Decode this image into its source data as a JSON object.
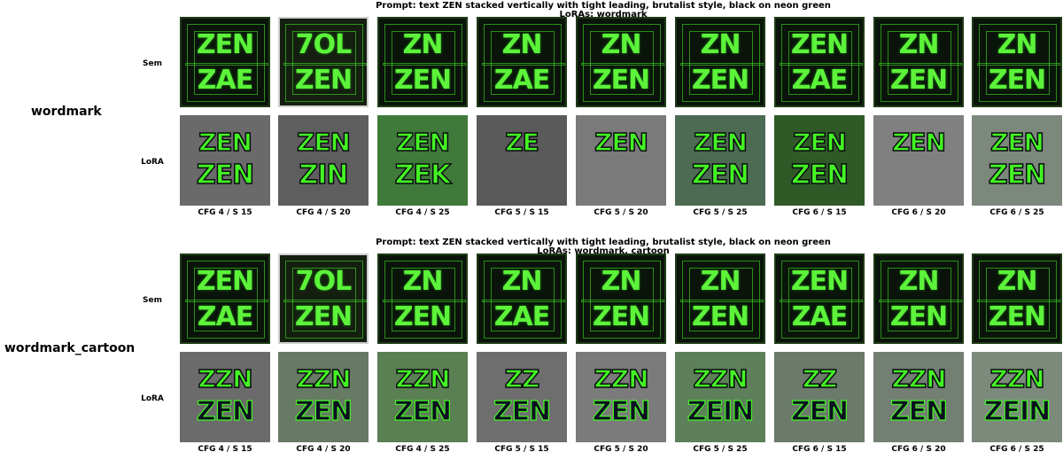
{
  "groups": [
    {
      "name": "wordmark",
      "prompt_line": "Prompt: text ZEN stacked vertically with tight leading, brutalist style, black on neon green",
      "loras_line": "LoRAs: wordmark",
      "row_labels": [
        "Sem",
        "LoRA"
      ],
      "captions": [
        "CFG 4 / S 15",
        "CFG 4 / S 20",
        "CFG 4 / S 25",
        "CFG 5 / S 15",
        "CFG 5 / S 20",
        "CFG 5 / S 25",
        "CFG 6 / S 15",
        "CFG 6 / S 20",
        "CFG 6 / S 25"
      ]
    },
    {
      "name": "wordmark_cartoon",
      "prompt_line": "Prompt: text ZEN stacked vertically with tight leading, brutalist style, black on neon green",
      "loras_line": "LoRAs: wordmark, cartoon",
      "row_labels": [
        "Sem",
        "LoRA"
      ],
      "captions": [
        "CFG 4 / S 15",
        "CFG 4 / S 20",
        "CFG 4 / S 25",
        "CFG 5 / S 15",
        "CFG 5 / S 20",
        "CFG 5 / S 25",
        "CFG 6 / S 15",
        "CFG 6 / S 20",
        "CFG 6 / S 25"
      ]
    }
  ],
  "tile_art": {
    "sem_top": [
      "ZEN",
      "7OL",
      "ZN",
      "ZN",
      "ZN",
      "ZN",
      "ZEN",
      "ZN",
      "ZN"
    ],
    "sem_bottom": [
      "ZAE",
      "ZEN",
      "ZEN",
      "ZAE",
      "ZEN",
      "ZEN",
      "ZAE",
      "ZEN",
      "ZEN"
    ],
    "g1_lora_top": [
      "ZEN",
      "ZEN",
      "ZEN",
      "ZE",
      "ZEN",
      "ZEN",
      "ZEN",
      "ZEN",
      "ZEN"
    ],
    "g1_lora_bottom": [
      "ZEN",
      "ZIN",
      "ZEK",
      "",
      "",
      "ZEN",
      "ZEN",
      "",
      "ZEN"
    ],
    "g2_lora_top": [
      "ZZN",
      "ZZN",
      "ZZN",
      "ZZ",
      "ZZN",
      "ZZN",
      "ZZ",
      "ZZN",
      "ZZN"
    ],
    "g2_lora_bottom": [
      "ZEN",
      "ZEN",
      "ZEN",
      "ZEN",
      "ZEN",
      "ZEIN",
      "ZEN",
      "ZEN",
      "ZEIN"
    ],
    "g1_lora_bg": [
      "#6a6a6a",
      "#5e5e5e",
      "#3f7a3a",
      "#5a5a5a",
      "#7a7a7a",
      "#4d6a52",
      "#2f5a28",
      "#808080",
      "#7d887d"
    ],
    "g2_lora_bg": [
      "#6b6b6b",
      "#677a64",
      "#5a7f52",
      "#6e6e6e",
      "#7b7b7b",
      "#5d805a",
      "#6b7a6b",
      "#737f73",
      "#7c8a7c"
    ],
    "neon_green": "#43f523",
    "dark_green_bg": "#0a140a"
  }
}
